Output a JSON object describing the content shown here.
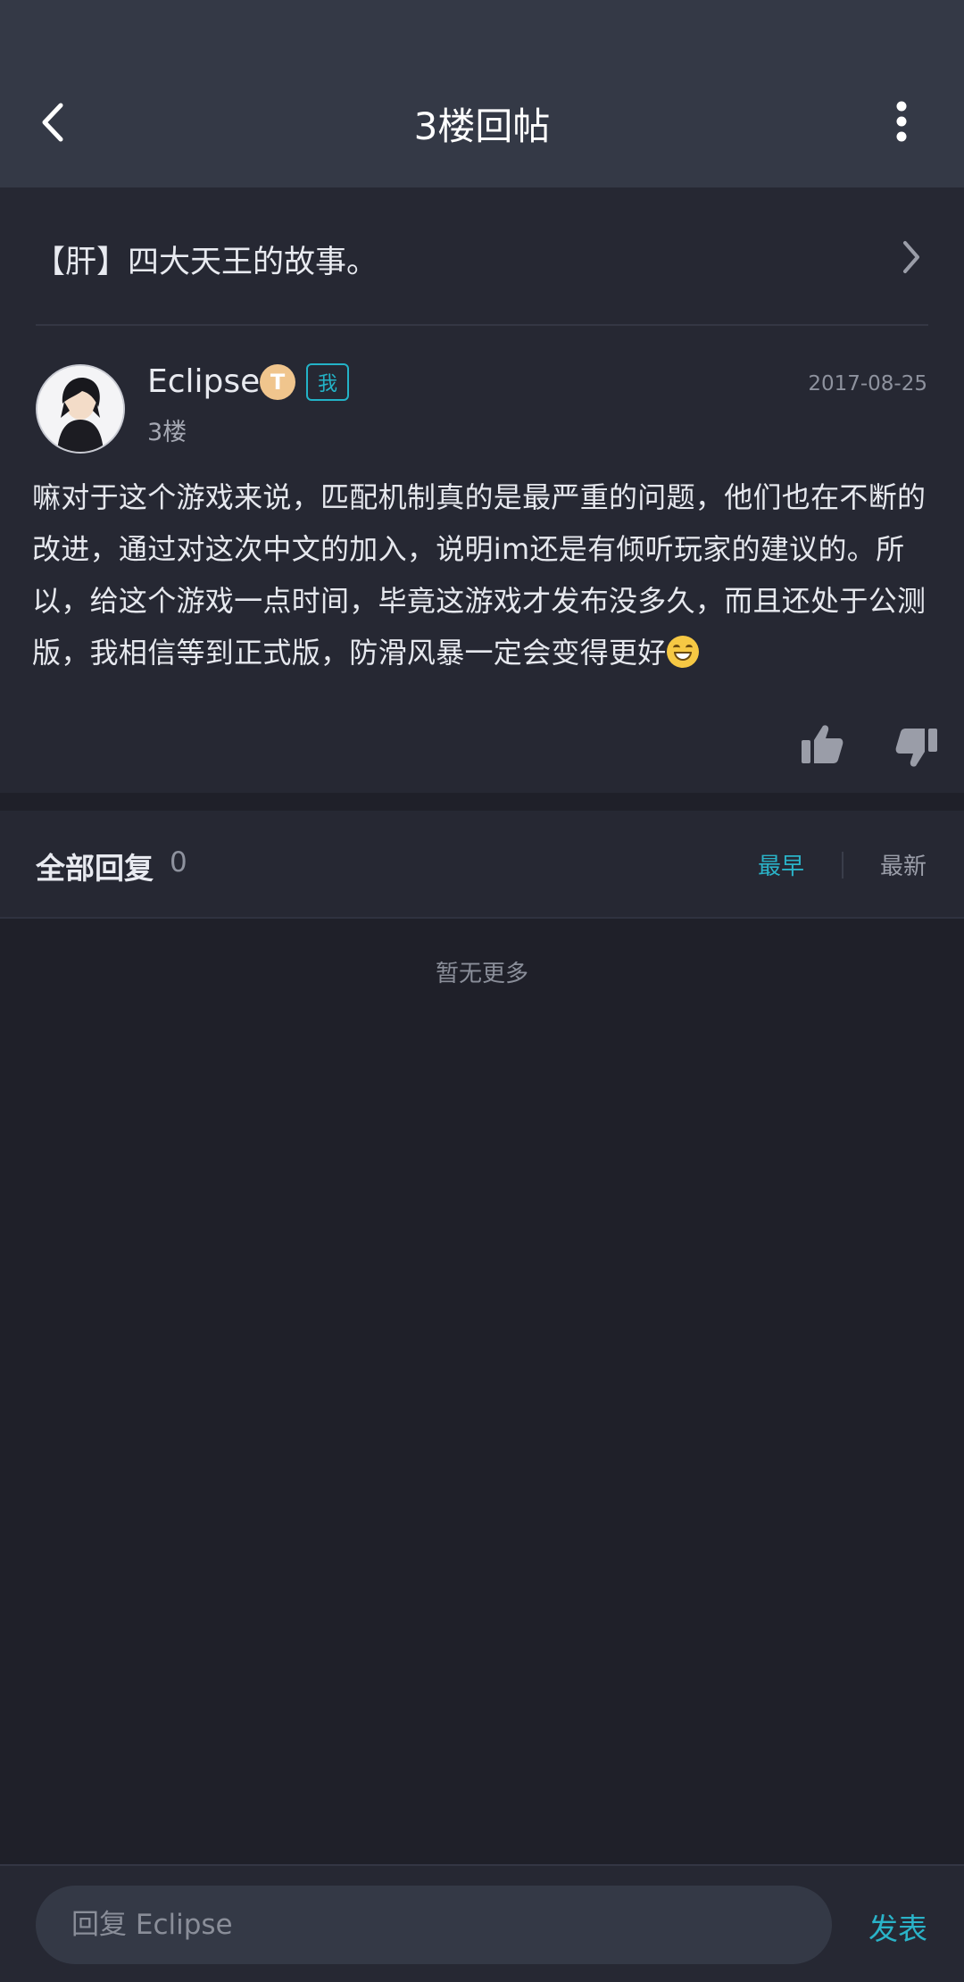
{
  "header": {
    "title": "3楼回帖",
    "back_icon": "chevron-left-icon",
    "more_icon": "vertical-dots-icon"
  },
  "thread": {
    "title": "【肝】四大天王的故事。"
  },
  "post": {
    "author": "Eclipse",
    "level_badge": "T",
    "me_tag": "我",
    "floor": "3楼",
    "date": "2017-08-25",
    "body": "嘛对于这个游戏来说，匹配机制真的是最严重的问题，他们也在不断的改进，通过对这次中文的加入，说明im还是有倾听玩家的建议的。所以，给这个游戏一点时间，毕竟这游戏才发布没多久，而且还处于公测版，我相信等到正式版，防滑风暴一定会变得更好"
  },
  "replies": {
    "title": "全部回复",
    "count": "0",
    "sort_earliest": "最早",
    "sort_newest": "最新",
    "empty_text": "暂无更多"
  },
  "bottom_bar": {
    "reply_placeholder": "回复 Eclipse",
    "publish_label": "发表"
  },
  "colors": {
    "accent": "#2ab3c8",
    "header_bg": "#343946",
    "card_bg": "#262833",
    "page_bg": "#1f2029"
  }
}
